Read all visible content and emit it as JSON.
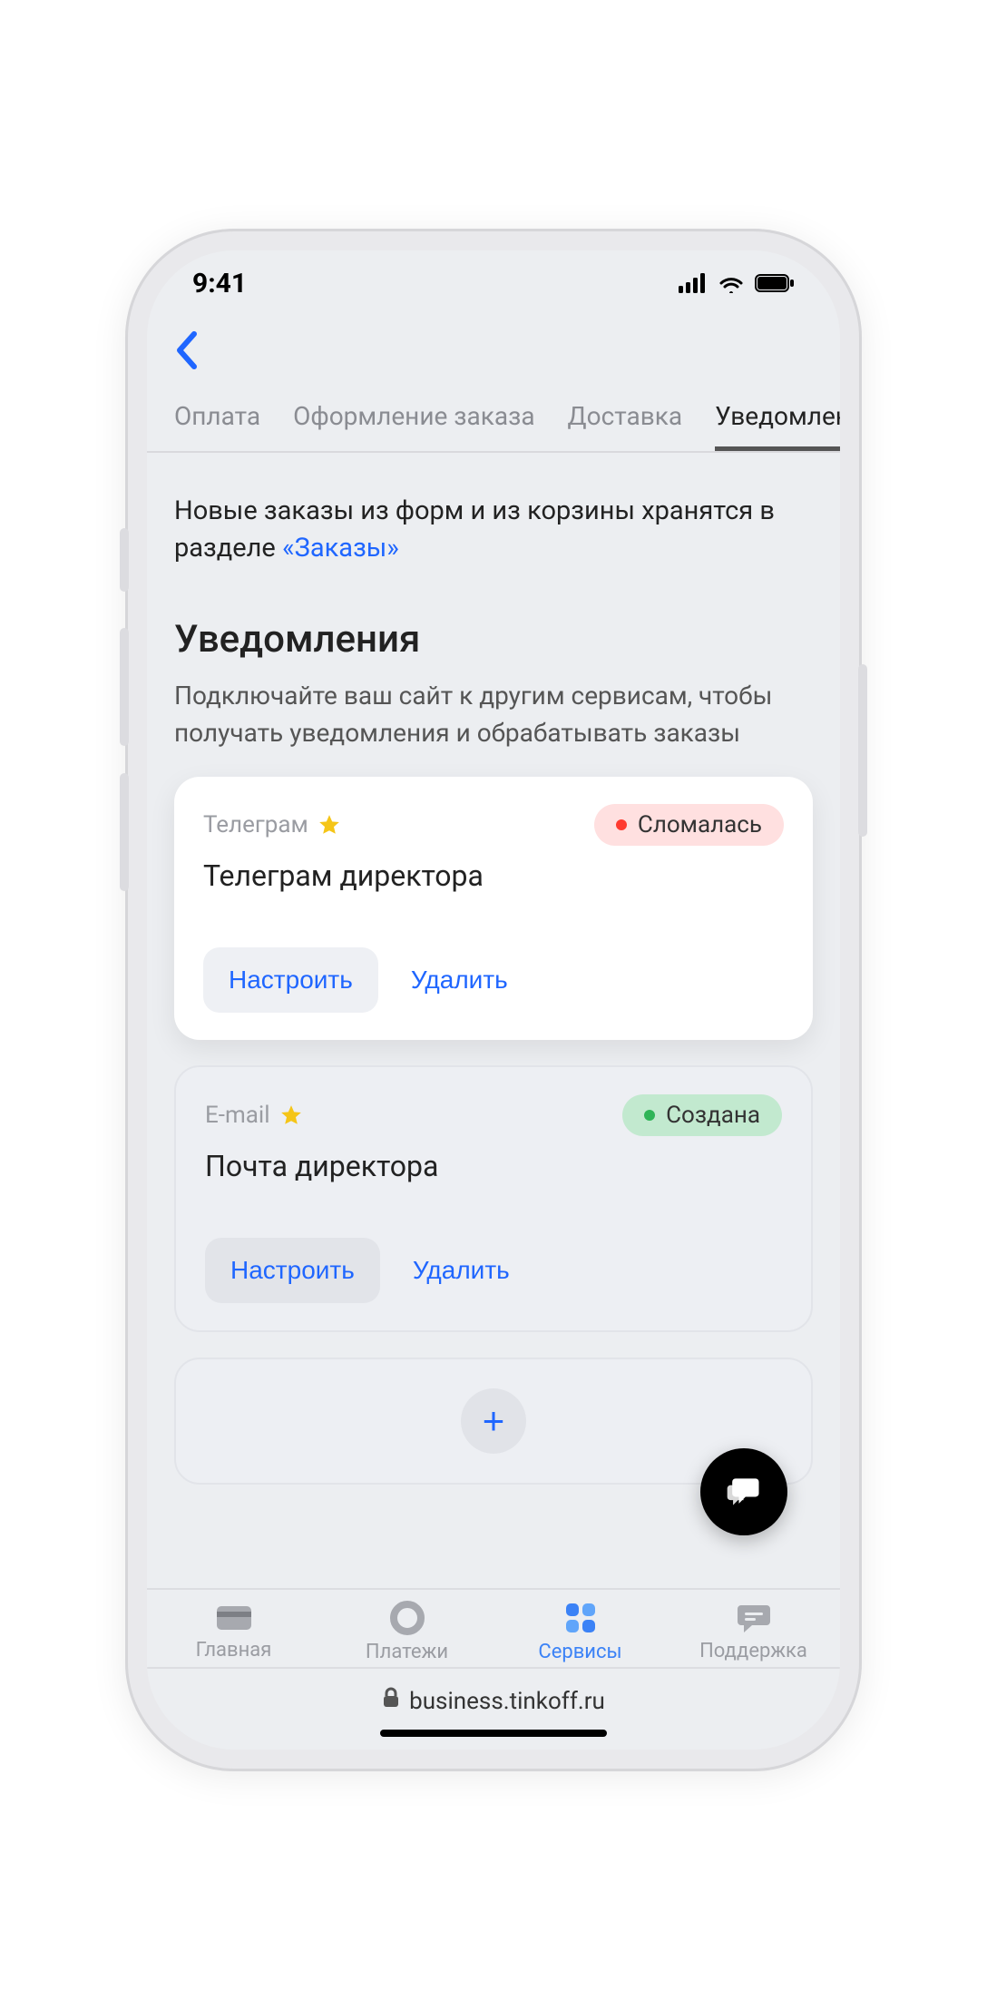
{
  "status_bar": {
    "time": "9:41"
  },
  "tabs": [
    {
      "label": "Оплата",
      "active": false
    },
    {
      "label": "Оформление заказа",
      "active": false
    },
    {
      "label": "Доставка",
      "active": false
    },
    {
      "label": "Уведомления",
      "active": true
    }
  ],
  "info": {
    "text_prefix": "Новые заказы из форм и из корзины хранятся в разделе ",
    "link_text": "«Заказы»"
  },
  "section": {
    "title": "Уведомления",
    "description": "Подключайте ваш сайт к другим сервисам, чтобы получать уведомления и обрабатывать заказы"
  },
  "cards": [
    {
      "type_label": "Телеграм",
      "title": "Телеграм директора",
      "status_label": "Сломалась",
      "status_kind": "broken",
      "actions": {
        "configure": "Настроить",
        "delete": "Удалить"
      },
      "variant": "white"
    },
    {
      "type_label": "E-mail",
      "title": "Почта директора",
      "status_label": "Создана",
      "status_kind": "created",
      "actions": {
        "configure": "Настроить",
        "delete": "Удалить"
      },
      "variant": "muted"
    }
  ],
  "tabbar": [
    {
      "label": "Главная",
      "icon": "card",
      "active": false
    },
    {
      "label": "Платежи",
      "icon": "circle",
      "active": false
    },
    {
      "label": "Сервисы",
      "icon": "grid",
      "active": true
    },
    {
      "label": "Поддержка",
      "icon": "support",
      "active": false
    }
  ],
  "browser": {
    "url": "business.tinkoff.ru"
  },
  "icons": {
    "plus": "+"
  }
}
